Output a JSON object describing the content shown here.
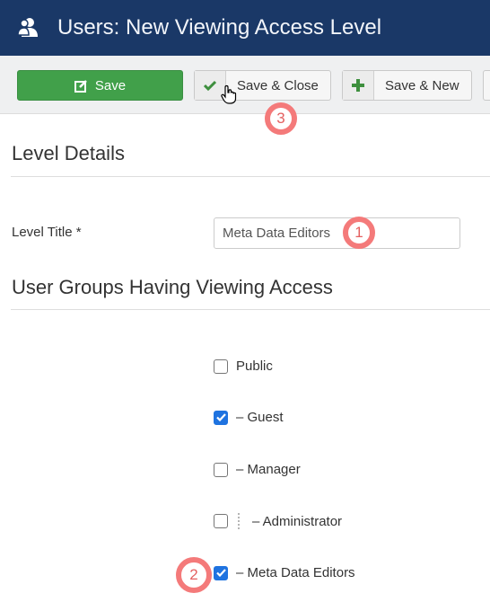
{
  "header": {
    "icon": "users-icon",
    "title": "Users: New Viewing Access Level"
  },
  "toolbar": {
    "save_label": "Save",
    "save_close_label": "Save & Close",
    "save_new_label": "Save & New",
    "colors": {
      "save_bg": "#41a04a",
      "icon_green": "#3e8f3e"
    }
  },
  "level_details": {
    "heading": "Level Details",
    "level_title_label": "Level Title *",
    "level_title_value": "Meta Data Editors"
  },
  "user_groups": {
    "heading": "User Groups Having Viewing Access",
    "groups": [
      {
        "label": "Public",
        "checked": false
      },
      {
        "label": "– Guest",
        "checked": true
      },
      {
        "label": "– Manager",
        "checked": false
      },
      {
        "label": "– Administrator",
        "checked": false
      },
      {
        "label": "– Meta Data Editors",
        "checked": true
      }
    ]
  },
  "annotations": {
    "step1": "1",
    "step2": "2",
    "step3": "3",
    "color": "#f47a7a"
  }
}
